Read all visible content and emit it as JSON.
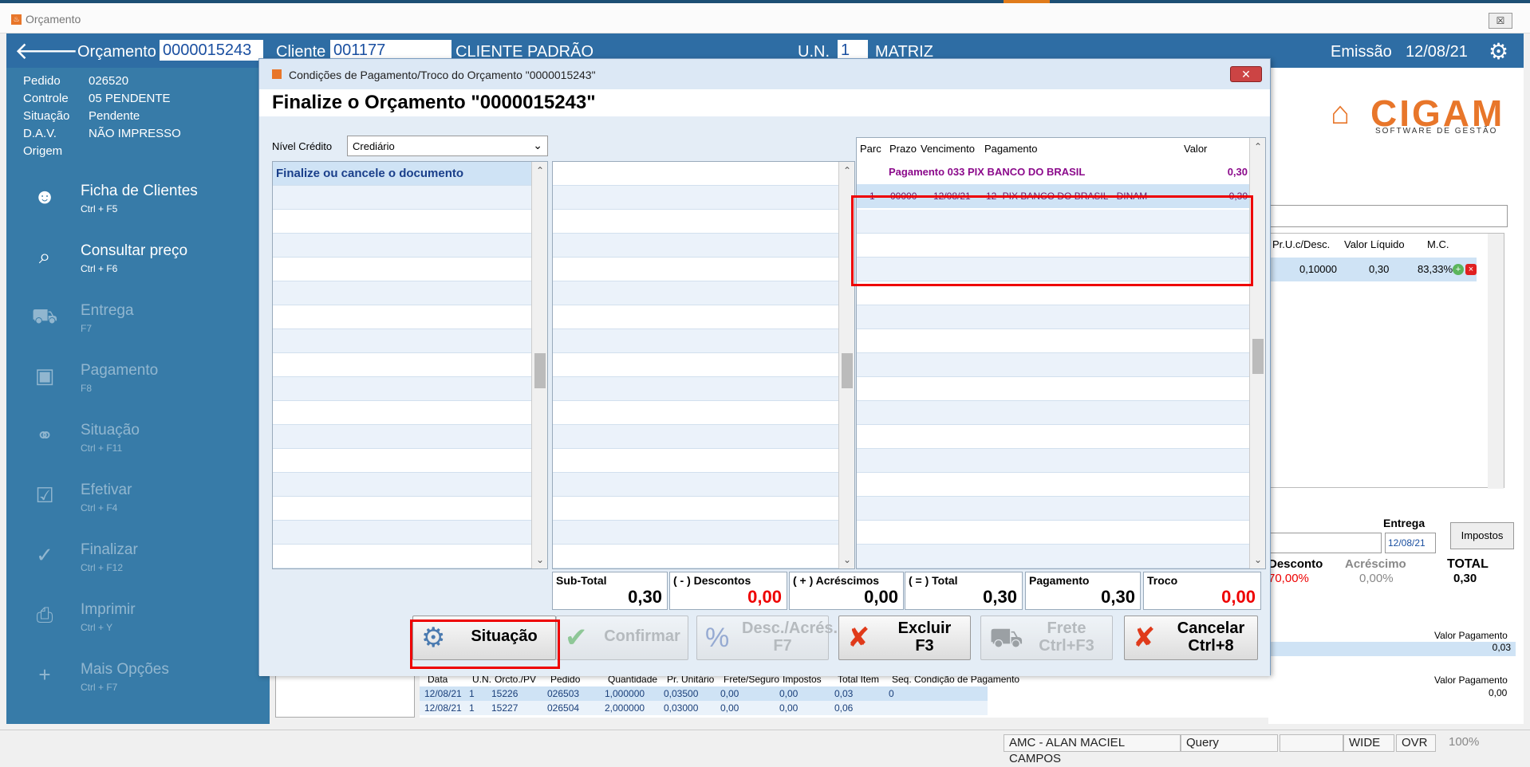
{
  "window": {
    "title": "Orçamento",
    "close": "☒"
  },
  "header": {
    "orcamento_label": "Orçamento",
    "orcamento_value": "0000015243",
    "cliente_label": "Cliente",
    "cliente_value": "001177",
    "cliente_name": "CLIENTE PADRÃO",
    "un_label": "U.N.",
    "un_value": "1",
    "un_name": "MATRIZ",
    "emissao_label": "Emissão",
    "emissao_value": "12/08/21"
  },
  "order_info": [
    {
      "label": "Pedido",
      "value": "026520"
    },
    {
      "label": "Controle",
      "value": "05  PENDENTE"
    },
    {
      "label": "Situação",
      "value": "Pendente"
    },
    {
      "label": "D.A.V.",
      "value": "NÃO IMPRESSO"
    },
    {
      "label": "Origem",
      "value": ""
    }
  ],
  "menu": [
    {
      "label": "Ficha de Clientes",
      "shortcut": "Ctrl + F5",
      "icon": "user-icon",
      "enabled": true
    },
    {
      "label": "Consultar preço",
      "shortcut": "Ctrl + F6",
      "icon": "price-search-icon",
      "enabled": true
    },
    {
      "label": "Entrega",
      "shortcut": "F7",
      "icon": "truck-icon",
      "enabled": false
    },
    {
      "label": "Pagamento",
      "shortcut": "F8",
      "icon": "money-icon",
      "enabled": false
    },
    {
      "label": "Situação",
      "shortcut": "Ctrl + F11",
      "icon": "link-icon",
      "enabled": false
    },
    {
      "label": "Efetivar",
      "shortcut": "Ctrl + F4",
      "icon": "document-check-icon",
      "enabled": false
    },
    {
      "label": "Finalizar",
      "shortcut": "Ctrl + F12",
      "icon": "check-icon",
      "enabled": false
    },
    {
      "label": "Imprimir",
      "shortcut": "Ctrl + Y",
      "icon": "printer-icon",
      "enabled": false
    },
    {
      "label": "Mais Opções",
      "shortcut": "Ctrl + F7",
      "icon": "plus-icon",
      "enabled": false
    }
  ],
  "logo": {
    "text": "CIGAM",
    "sub": "SOFTWARE DE GESTÃO"
  },
  "right_grid": {
    "headers": [
      "Pr.U.c/Desc.",
      "Valor Líquido",
      "M.C."
    ],
    "row": [
      "0,10000",
      "0,30",
      "83,33%"
    ]
  },
  "right_totals": {
    "entrega_label": "Entrega",
    "entrega_value": "12/08/21",
    "impostos_button": "Impostos",
    "desconto_label": "Desconto",
    "desconto_value": "70,00%",
    "acrescimo_label": "Acréscimo",
    "acrescimo_value": "0,00%",
    "total_label": "TOTAL",
    "total_value": "0,30",
    "valor_pag_label": "Valor Pagamento",
    "valor_pag_value": "0,03",
    "valor_pag_label2": "Valor Pagamento",
    "valor_pag_value2": "0,00"
  },
  "bottom_table": {
    "headers": [
      "Data",
      "U.N.",
      "Orcto./PV",
      "Pedido",
      "Quantidade",
      "Pr. Unitário",
      "Frete/Seguro",
      "Impostos",
      "Total Item",
      "Seq.",
      "Condição de Pagamento"
    ],
    "rows": [
      [
        "12/08/21",
        "1",
        "15226",
        "026503",
        "1,000000",
        "0,03500",
        "0,00",
        "0,00",
        "0,03",
        "0",
        ""
      ],
      [
        "12/08/21",
        "1",
        "15227",
        "026504",
        "2,000000",
        "0,03000",
        "0,00",
        "0,00",
        "0,06",
        "",
        ""
      ]
    ]
  },
  "dialog": {
    "title": "Condições de Pagamento/Troco do Orçamento \"0000015243\"",
    "heading": "Finalize o Orçamento \"0000015243\"",
    "nivel_label": "Nível Crédito",
    "nivel_value": "Crediário",
    "list_first": "Finalize ou cancele o documento",
    "pay_headers": [
      "Parc",
      "Prazo",
      "Vencimento",
      "Pagamento",
      "Valor"
    ],
    "pay_group": {
      "label": "Pagamento  033  PIX BANCO DO BRASIL",
      "valor": "0,30"
    },
    "pay_row": {
      "parc": "1",
      "prazo": "00000",
      "venc": "12/08/21",
      "pag": "12 -PIX BANCO DO BRASIL - DINAM",
      "valor": "0,30"
    },
    "totals": [
      {
        "label": "Sub-Total",
        "value": "0,30",
        "color": "#000"
      },
      {
        "label": "( - ) Descontos",
        "value": "0,00",
        "color": "#e00"
      },
      {
        "label": "( + ) Acréscimos",
        "value": "0,00",
        "color": "#000"
      },
      {
        "label": "( = ) Total",
        "value": "0,30",
        "color": "#000"
      },
      {
        "label": "Pagamento",
        "value": "0,30",
        "color": "#000"
      },
      {
        "label": "Troco",
        "value": "0,00",
        "color": "#e00"
      }
    ],
    "buttons": [
      {
        "label": "Situação",
        "icon": "gear-icon",
        "enabled": true
      },
      {
        "label": "Confirmar",
        "icon": "check-icon",
        "enabled": false
      },
      {
        "label": "Desc./Acrés.\nF7",
        "icon": "percent-icon",
        "enabled": false
      },
      {
        "label": "Excluir\nF3",
        "icon": "x-icon",
        "enabled": true
      },
      {
        "label": "Frete\nCtrl+F3",
        "icon": "truck-icon",
        "enabled": false
      },
      {
        "label": "Cancelar\nCtrl+8",
        "icon": "x-icon",
        "enabled": true
      }
    ]
  },
  "status": {
    "user": "AMC - ALAN MACIEL CAMPOS",
    "mode": "Query",
    "wide": "WIDE",
    "ovr": "OVR",
    "zoom": "100%"
  }
}
